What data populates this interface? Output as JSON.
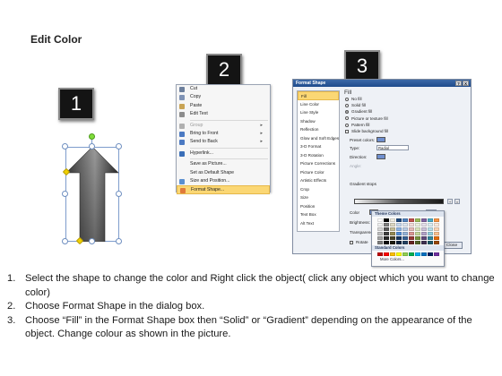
{
  "page": {
    "title": "Edit Color"
  },
  "steps": {
    "one": "1",
    "two": "2",
    "three": "3"
  },
  "context_menu": {
    "items": [
      {
        "label": "Cut",
        "icon": "scissors-icon",
        "color": "#6c7f9c",
        "disabled": false,
        "submenu": false,
        "highlighted": false
      },
      {
        "label": "Copy",
        "icon": "copy-icon",
        "color": "#7f93b5",
        "disabled": false,
        "submenu": false,
        "highlighted": false
      },
      {
        "label": "Paste",
        "icon": "paste-icon",
        "color": "#c9a455",
        "disabled": false,
        "submenu": false,
        "highlighted": false
      },
      {
        "label": "Edit Text",
        "icon": "edit-text-icon",
        "color": "#8c8c8c",
        "disabled": false,
        "submenu": false,
        "highlighted": false
      },
      {
        "sep": true
      },
      {
        "label": "Group",
        "icon": "group-icon",
        "color": "#b0b0b0",
        "disabled": true,
        "submenu": true,
        "highlighted": false
      },
      {
        "label": "Bring to Front",
        "icon": "bring-front-icon",
        "color": "#4b79c2",
        "disabled": false,
        "submenu": true,
        "highlighted": false
      },
      {
        "label": "Send to Back",
        "icon": "send-back-icon",
        "color": "#4b79c2",
        "disabled": false,
        "submenu": true,
        "highlighted": false
      },
      {
        "sep": true
      },
      {
        "label": "Hyperlink...",
        "icon": "hyperlink-icon",
        "color": "#3a6fb8",
        "disabled": false,
        "submenu": false,
        "highlighted": false
      },
      {
        "sep": true
      },
      {
        "label": "Save as Picture...",
        "icon": "",
        "color": "",
        "disabled": false,
        "submenu": false,
        "highlighted": false
      },
      {
        "label": "Set as Default Shape",
        "icon": "",
        "color": "",
        "disabled": false,
        "submenu": false,
        "highlighted": false
      },
      {
        "label": "Size and Position...",
        "icon": "size-position-icon",
        "color": "#5b8fd0",
        "disabled": false,
        "submenu": false,
        "highlighted": false
      },
      {
        "label": "Format Shape...",
        "icon": "format-shape-icon",
        "color": "#e07a3a",
        "disabled": false,
        "submenu": false,
        "highlighted": true
      }
    ]
  },
  "format_dialog": {
    "title": "Format Shape",
    "help": "?",
    "close_x": "X",
    "sidebar": [
      "Fill",
      "Line Color",
      "Line Style",
      "Shadow",
      "Reflection",
      "Glow and Soft Edges",
      "3-D Format",
      "3-D Rotation",
      "Picture Corrections",
      "Picture Color",
      "Artistic Effects",
      "Crop",
      "Size",
      "Position",
      "Text Box",
      "Alt Text"
    ],
    "selected_section": "Fill",
    "fill_heading": "Fill",
    "fill_options": [
      {
        "label": "No fill",
        "checked": false,
        "kind": "radio"
      },
      {
        "label": "Solid fill",
        "checked": false,
        "kind": "radio"
      },
      {
        "label": "Gradient fill",
        "checked": true,
        "kind": "radio"
      },
      {
        "label": "Picture or texture fill",
        "checked": false,
        "kind": "radio"
      },
      {
        "label": "Pattern fill",
        "checked": false,
        "kind": "radio"
      },
      {
        "label": "Slide background fill",
        "checked": false,
        "kind": "checkbox"
      }
    ],
    "preset_colors_label": "Preset colors:",
    "type_label": "Type:",
    "type_value": "Radial",
    "direction_label": "Direction:",
    "angle_label": "Angle:",
    "gradient_stops_label": "Gradient stops",
    "color_label": "Color",
    "position_label": "Position:",
    "position_value": "0%",
    "brightness_label": "Brightness:",
    "transparency_label": "Transparency:",
    "rotate_label": "Rotate",
    "close_button": "Close"
  },
  "color_popup": {
    "theme_heading": "Theme Colors",
    "standard_heading": "Standard Colors",
    "more_colors": "More Colors...",
    "theme_top": [
      "#ffffff",
      "#000000",
      "#eeece1",
      "#1f497d",
      "#4f81bd",
      "#c0504d",
      "#9bbb59",
      "#8064a2",
      "#4bacc6",
      "#f79646"
    ],
    "theme_shades": [
      [
        "#f2f2f2",
        "#7f7f7f",
        "#ddd9c3",
        "#c6d9f0",
        "#dbe5f1",
        "#f2dcdb",
        "#ebf1dd",
        "#e5e0ec",
        "#dbeef3",
        "#fdeada"
      ],
      [
        "#d8d8d8",
        "#595959",
        "#c4bd97",
        "#8db3e2",
        "#b8cce4",
        "#e5b9b7",
        "#d7e3bc",
        "#ccc1d9",
        "#b7dde8",
        "#fbd5b5"
      ],
      [
        "#bfbfbf",
        "#3f3f3f",
        "#938953",
        "#548dd4",
        "#95b3d7",
        "#d99694",
        "#c3d69b",
        "#b2a2c7",
        "#92cddc",
        "#fac08f"
      ],
      [
        "#a5a5a5",
        "#262626",
        "#494429",
        "#17365d",
        "#366092",
        "#953734",
        "#76923c",
        "#5f497a",
        "#31859b",
        "#e36c09"
      ],
      [
        "#7f7f7f",
        "#0c0c0c",
        "#1d1b10",
        "#0f243e",
        "#244061",
        "#632423",
        "#4f6128",
        "#3f3151",
        "#205867",
        "#974806"
      ]
    ],
    "standard": [
      "#c00000",
      "#ff0000",
      "#ffc000",
      "#ffff00",
      "#92d050",
      "#00b050",
      "#00b0f0",
      "#0070c0",
      "#002060",
      "#7030a0"
    ]
  },
  "instructions": [
    {
      "num": "1.",
      "text": "Select the shape to change the color and Right click the object( click any object which you want to change color)"
    },
    {
      "num": "2.",
      "text": "Choose Format Shape in the dialog box."
    },
    {
      "num": "3.",
      "text": "Choose “Fill” in the Format Shape box then “Solid” or “Gradient” depending on the appearance of the object. Change colour as shown in the picture."
    }
  ]
}
